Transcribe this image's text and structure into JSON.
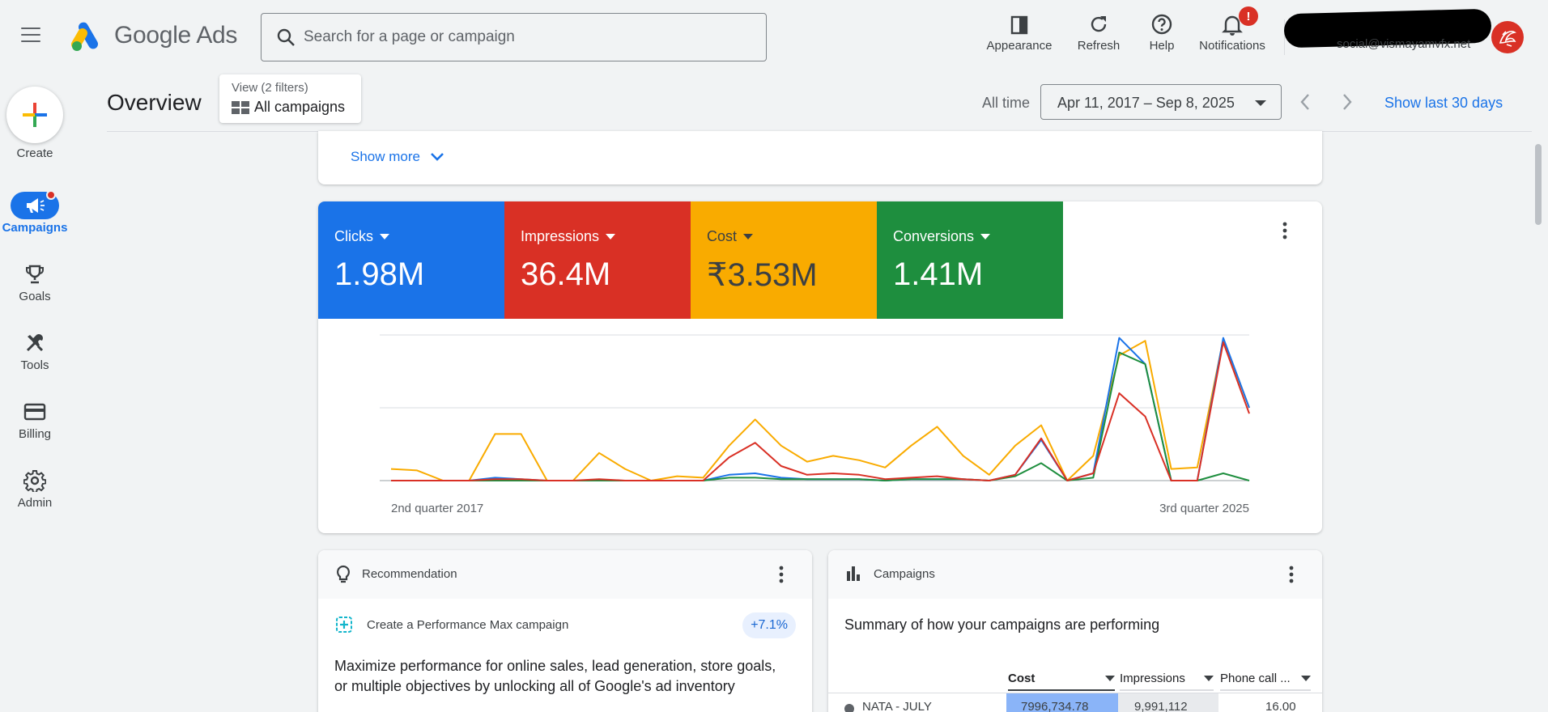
{
  "app": {
    "brand": "Google Ads"
  },
  "header": {
    "search_placeholder": "Search for a page or campaign",
    "tools": {
      "appearance": "Appearance",
      "refresh": "Refresh",
      "help": "Help",
      "notifications": "Notifications"
    },
    "notification_badge": "!",
    "account_email": "social@vismayamvfx.net"
  },
  "sidenav": {
    "create": "Create",
    "items": {
      "campaigns": "Campaigns",
      "goals": "Goals",
      "tools": "Tools",
      "billing": "Billing",
      "admin": "Admin"
    }
  },
  "subheader": {
    "title": "Overview",
    "view_filters": "View (2 filters)",
    "view_name": "All campaigns",
    "range_label": "All time",
    "date_range": "Apr 11, 2017 – Sep 8, 2025",
    "show_last": "Show last 30 days"
  },
  "show_more": "Show more",
  "metrics": {
    "clicks": {
      "label": "Clicks",
      "value": "1.98M",
      "color": "#1a73e8"
    },
    "impressions": {
      "label": "Impressions",
      "value": "36.4M",
      "color": "#d93025"
    },
    "cost": {
      "label": "Cost",
      "value": "₹3.53M",
      "color": "#f9ab00"
    },
    "conversions": {
      "label": "Conversions",
      "value": "1.41M",
      "color": "#1e8e3e"
    }
  },
  "chart_data": {
    "type": "line",
    "x_start_label": "2nd quarter 2017",
    "x_end_label": "3rd quarter 2025",
    "grid": true,
    "ylim": [
      0,
      100
    ],
    "series": [
      {
        "name": "Cost",
        "color": "#f9ab00",
        "values": [
          8,
          7,
          0,
          0,
          32,
          32,
          0,
          0,
          19,
          8,
          0,
          3,
          2,
          24,
          42,
          24,
          13,
          17,
          14,
          9,
          24,
          37,
          17,
          4,
          24,
          38,
          0,
          17,
          86,
          96,
          8,
          9,
          97,
          50
        ]
      },
      {
        "name": "Clicks",
        "color": "#1a73e8",
        "values": [
          0,
          0,
          0,
          0,
          2,
          1,
          0,
          0,
          0,
          0,
          0,
          0,
          0,
          4,
          5,
          2,
          1,
          1,
          1,
          0,
          1,
          1,
          1,
          0,
          4,
          28,
          0,
          5,
          98,
          80,
          0,
          0,
          98,
          50
        ]
      },
      {
        "name": "Conversions",
        "color": "#1e8e3e",
        "values": [
          0,
          0,
          0,
          0,
          0,
          0,
          0,
          0,
          0,
          0,
          0,
          0,
          0,
          2,
          2,
          1,
          1,
          1,
          1,
          0,
          1,
          1,
          1,
          0,
          3,
          12,
          0,
          2,
          88,
          80,
          0,
          0,
          5,
          0
        ]
      },
      {
        "name": "Impressions",
        "color": "#d93025",
        "values": [
          0,
          0,
          0,
          0,
          1,
          1,
          0,
          0,
          1,
          0,
          0,
          0,
          0,
          16,
          26,
          10,
          4,
          5,
          4,
          1,
          2,
          3,
          1,
          0,
          4,
          29,
          0,
          5,
          60,
          44,
          0,
          0,
          95,
          46
        ]
      }
    ]
  },
  "recommendation": {
    "header": "Recommendation",
    "title": "Create a Performance Max campaign",
    "badge": "+7.1%",
    "description": "Maximize performance for online sales, lead generation, store goals, or multiple objectives by unlocking all of Google's ad inventory"
  },
  "campaigns_card": {
    "header": "Campaigns",
    "summary": "Summary of how your campaigns are performing",
    "columns": [
      "Cost",
      "Impressions",
      "Phone call ..."
    ],
    "row": [
      "NATA - JULY",
      "7996,734.78",
      "9,991,112",
      "16.00"
    ]
  }
}
